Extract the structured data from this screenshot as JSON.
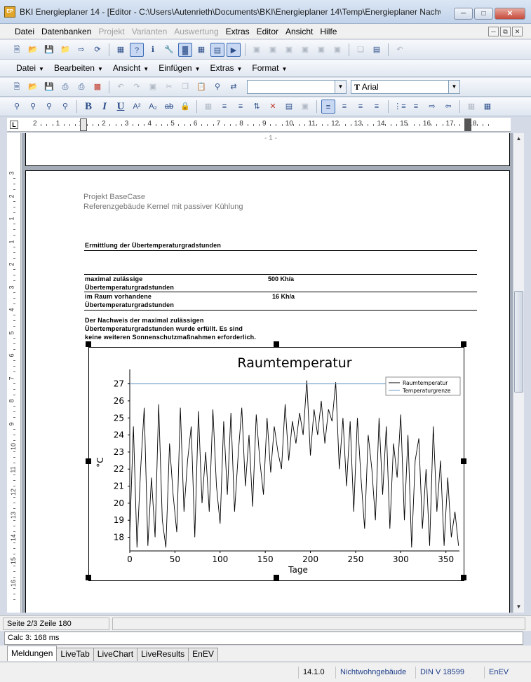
{
  "window": {
    "title": "BKI Energieplaner 14 - [Editor - C:\\Users\\Autenrieth\\Documents\\BKI\\Energieplaner 14\\Temp\\Energieplaner Nachw...",
    "icon_text": "EP"
  },
  "menu": {
    "items": [
      {
        "label": "Datei",
        "enabled": true
      },
      {
        "label": "Datenbanken",
        "enabled": true
      },
      {
        "label": "Projekt",
        "enabled": false
      },
      {
        "label": "Varianten",
        "enabled": false
      },
      {
        "label": "Auswertung",
        "enabled": false
      },
      {
        "label": "Extras",
        "enabled": true
      },
      {
        "label": "Editor",
        "enabled": true
      },
      {
        "label": "Ansicht",
        "enabled": true
      },
      {
        "label": "Hilfe",
        "enabled": true
      }
    ]
  },
  "editor_menu": {
    "items": [
      "Datei",
      "Bearbeiten",
      "Ansicht",
      "Einfügen",
      "Extras",
      "Format"
    ]
  },
  "font": {
    "style_value": "",
    "font_value": "Arial"
  },
  "ruler": {
    "marks": [
      "2",
      "1",
      "1",
      "2",
      "3",
      "4",
      "5",
      "6",
      "7",
      "8",
      "9",
      "10",
      "11",
      "12",
      "13",
      "14",
      "15",
      "16",
      "17",
      "18"
    ]
  },
  "vruler": {
    "marks": [
      "3",
      "2",
      "1",
      "1",
      "2",
      "3",
      "4",
      "5",
      "6",
      "7",
      "8",
      "9",
      "10",
      "11",
      "12",
      "13",
      "14",
      "15",
      "16"
    ]
  },
  "document": {
    "prev_page_number": "- 1 -",
    "project_line": "Projekt BaseCase",
    "subtitle_line": "Referenzgebäude Kernel mit passiver Kühlung",
    "section_title": "Ermittlung der Übertemperaturgradstunden",
    "rows": [
      {
        "label_1": "maximal zulässige",
        "label_2": "Übertemperaturgradstunden",
        "value": "500 Kh/a"
      },
      {
        "label_1": "im Raum vorhandene",
        "label_2": "Übertemperaturgradstunden",
        "value": "16 Kh/a"
      }
    ],
    "note": [
      "Der Nachweis der maximal zulässigen",
      "Übertemperaturgradstunden wurde erfüllt. Es sind",
      "keine weiteren Sonnenschutzmaßnahmen erforderlich."
    ]
  },
  "chart_data": {
    "type": "line",
    "title": "Raumtemperatur",
    "xlabel": "Tage",
    "ylabel": "°C",
    "xlim": [
      0,
      365
    ],
    "ylim": [
      17.2,
      27.6
    ],
    "xticks": [
      0,
      50,
      100,
      150,
      200,
      250,
      300,
      350
    ],
    "yticks": [
      18,
      19,
      20,
      21,
      22,
      23,
      24,
      25,
      26,
      27
    ],
    "legend_position": "top-right",
    "series": [
      {
        "name": "Raumtemperatur",
        "color": "#000000",
        "x": [
          0,
          4,
          8,
          12,
          16,
          20,
          24,
          28,
          32,
          36,
          40,
          44,
          48,
          52,
          56,
          60,
          64,
          68,
          72,
          76,
          80,
          84,
          88,
          92,
          96,
          100,
          104,
          108,
          112,
          116,
          120,
          124,
          128,
          132,
          136,
          140,
          144,
          148,
          152,
          156,
          160,
          164,
          168,
          172,
          176,
          180,
          184,
          188,
          192,
          196,
          200,
          204,
          208,
          212,
          216,
          220,
          224,
          228,
          232,
          236,
          240,
          244,
          248,
          252,
          256,
          260,
          264,
          268,
          272,
          276,
          280,
          284,
          288,
          292,
          296,
          300,
          304,
          308,
          312,
          316,
          320,
          324,
          328,
          332,
          336,
          340,
          344,
          348,
          352,
          356,
          360,
          364
        ],
        "values": [
          18.2,
          24.5,
          17.4,
          22.0,
          25.6,
          17.5,
          21.5,
          18.0,
          25.8,
          19.0,
          17.4,
          23.5,
          20.5,
          18.3,
          25.6,
          19.5,
          22.5,
          24.5,
          18.0,
          25.4,
          20.0,
          23.0,
          19.5,
          25.5,
          21.0,
          18.8,
          24.8,
          20.5,
          25.3,
          19.5,
          22.8,
          25.6,
          21.0,
          24.0,
          19.8,
          25.2,
          22.5,
          20.5,
          25.0,
          21.8,
          24.5,
          23.0,
          22.0,
          25.8,
          22.5,
          24.8,
          23.5,
          25.3,
          24.0,
          27.2,
          22.8,
          25.5,
          24.0,
          26.0,
          23.5,
          25.5,
          24.8,
          27.1,
          22.0,
          25.0,
          21.0,
          24.8,
          19.5,
          25.0,
          21.5,
          18.5,
          24.0,
          22.0,
          19.0,
          25.0,
          20.5,
          24.5,
          18.5,
          23.5,
          21.5,
          25.2,
          19.0,
          24.0,
          17.4,
          22.5,
          23.8,
          18.5,
          22.0,
          17.5,
          24.5,
          19.5,
          22.5,
          17.5,
          21.5,
          18.0,
          19.5,
          17.5
        ]
      },
      {
        "name": "Temperaturgrenze",
        "color": "#6f9bc9",
        "x": [
          0,
          365
        ],
        "values": [
          27,
          27
        ]
      }
    ]
  },
  "status": {
    "position": "Seite 2/3 Zeile 180",
    "calc": "Calc 3: 168 ms",
    "version": "14.1.0",
    "building_type": "Nichtwohngebäude",
    "norm": "DIN V 18599",
    "regulation": "EnEV"
  },
  "bottom_tabs": [
    {
      "label": "Meldungen",
      "active": true
    },
    {
      "label": "LiveTab",
      "active": false
    },
    {
      "label": "LiveChart",
      "active": false
    },
    {
      "label": "LiveResults",
      "active": false
    },
    {
      "label": "EnEV",
      "active": false
    }
  ]
}
